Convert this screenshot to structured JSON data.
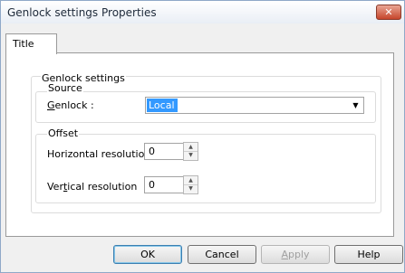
{
  "window": {
    "title": "Genlock settings Properties",
    "close_glyph": "✕"
  },
  "tabs": [
    {
      "label": "Title",
      "selected": true
    }
  ],
  "genlock_settings": {
    "group_label": "Genlock settings",
    "source": {
      "group_label": "Source",
      "genlock_label": "Genlock :",
      "genlock_value": "Local"
    },
    "offset": {
      "group_label": "Offset",
      "horizontal_label": "Horizontal resolution",
      "horizontal_value": "0",
      "vertical_label": "Vertical resolution",
      "vertical_value": "0"
    }
  },
  "buttons": {
    "ok": "OK",
    "cancel": "Cancel",
    "apply": "Apply",
    "help": "Help"
  },
  "icons": {
    "dropdown": "chevron-down-icon",
    "spin_up": "arrow-up-icon",
    "spin_down": "arrow-down-icon",
    "close": "close-icon"
  },
  "colors": {
    "selection": "#3399ff",
    "close_button": "#c6452b",
    "dialog_background": "#f0f0f0"
  }
}
